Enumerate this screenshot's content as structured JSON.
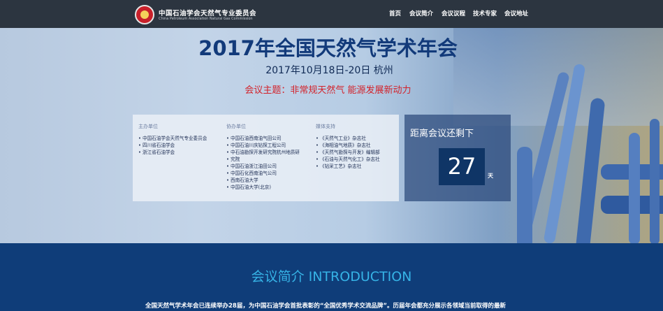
{
  "header": {
    "org_name": "中国石油学会天然气专业委员会",
    "org_name_en": "China Petroleum Association Natural Gas Commission",
    "nav": [
      {
        "label": "首页"
      },
      {
        "label": "会议简介"
      },
      {
        "label": "会议议程"
      },
      {
        "label": "技术专家"
      },
      {
        "label": "会议地址"
      }
    ]
  },
  "hero": {
    "title": "2017年全国天然气学术年会",
    "date": "2017年10月18日-20日 杭州",
    "theme": "会议主题：非常规天然气 能源发展新动力"
  },
  "organizers": {
    "host": {
      "title": "主办单位",
      "items": [
        "中国石油学会天然气专业委员会",
        "四川省石油学会",
        "浙江省石油学会"
      ]
    },
    "co": {
      "title": "协办单位",
      "items": [
        "中国石油西南油气田公司",
        "中国石油川庆钻探工程公司",
        "中石油勘探开发研究院杭州地质研",
        "究院",
        "中国石油浙江油田公司",
        "中国石化西南油气公司",
        "西南石油大学",
        "中国石油大学(北京)"
      ]
    },
    "media": {
      "title": "媒体支持",
      "items": [
        "《天然气工业》杂志社",
        "《海相油气地质》杂志社",
        "《天然气勘探与开发》编辑部",
        "《石油与天然气化工》杂志社",
        "《钻采工艺》杂志社"
      ]
    }
  },
  "countdown": {
    "label": "距离会议还剩下",
    "days": "27",
    "unit": "天"
  },
  "intro": {
    "title": "会议简介 INTRODUCTION",
    "text": "全国天然气学术年会已连续举办28届，为中国石油学会首批表彰的“全国优秀学术交流品牌”。历届年会都充分展示各领域当前取得的最新"
  }
}
